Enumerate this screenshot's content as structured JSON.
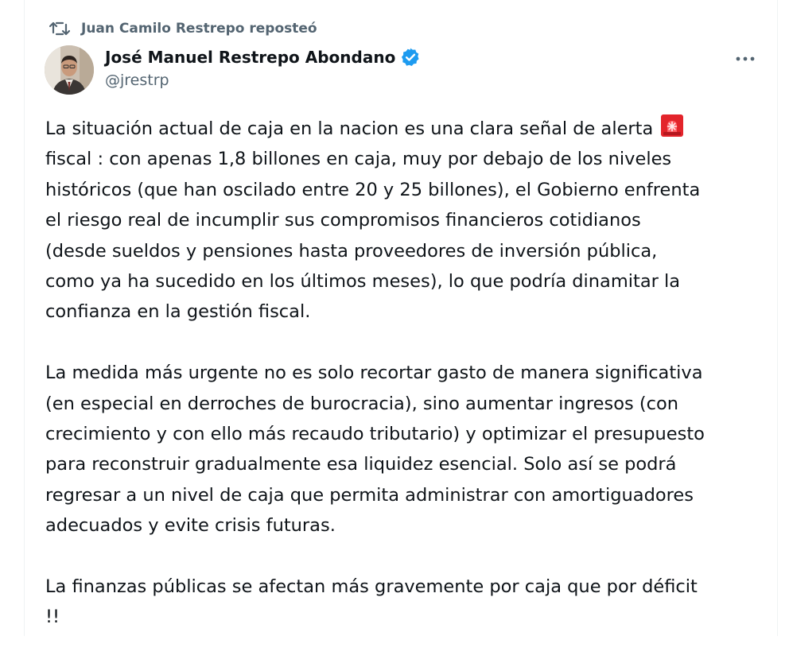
{
  "repost": {
    "icon": "repost-icon",
    "label": "Juan Camilo Restrepo reposteó"
  },
  "author": {
    "name": "José Manuel Restrepo Abondano",
    "handle": "@jrestrp",
    "verified": true,
    "verified_color": "#1d9bf0"
  },
  "menu": {
    "icon": "more-options-icon"
  },
  "tweet": {
    "paragraph_1": "La situación actual de caja en la nacion es una clara señal de alerta",
    "paragraph_1_emoji": "rotating-light-icon",
    "paragraph_1_rest": "fiscal : con apenas 1,8 billones en caja, muy por debajo de los niveles\nhistóricos (que han oscilado entre 20 y 25 billones), el Gobierno enfrenta\nel riesgo real de incumplir sus compromisos financieros cotidianos\n(desde sueldos y pensiones hasta proveedores de inversión pública,\ncomo ya ha sucedido en los últimos meses), lo que podría dinamitar la\nconfianza en la gestión fiscal.",
    "paragraph_2": "La medida más urgente no es solo recortar gasto de manera significativa\n(en especial en derroches de burocracia), sino aumentar ingresos (con\ncrecimiento y con ello más recaudo tributario) y optimizar el presupuesto\npara reconstruir gradualmente esa liquidez esencial. Solo así se podrá\nregresar a un nivel de caja que permita administrar con amortiguadores\nadecuados y evite crisis futuras.",
    "paragraph_3": "La finanzas públicas se afectan más gravemente por caja que por déficit\n!!"
  },
  "colors": {
    "text": "#0f1419",
    "secondary": "#536471",
    "alert_red": "#e3242b"
  }
}
